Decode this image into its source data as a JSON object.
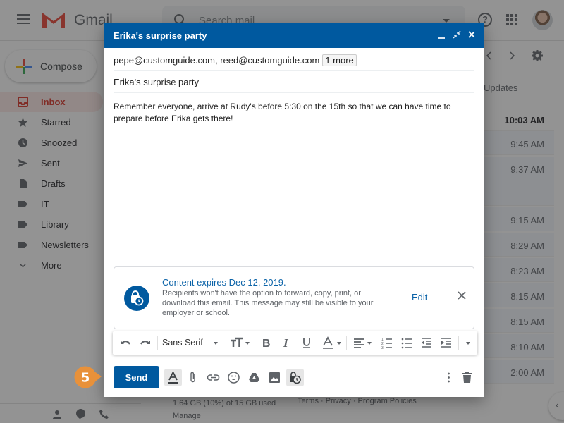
{
  "app": {
    "name": "Gmail",
    "search_placeholder": "Search mail",
    "compose_label": "Compose"
  },
  "sidebar": {
    "items": [
      {
        "label": "Inbox",
        "icon": "inbox-icon",
        "active": true
      },
      {
        "label": "Starred",
        "icon": "star-icon"
      },
      {
        "label": "Snoozed",
        "icon": "clock-icon"
      },
      {
        "label": "Sent",
        "icon": "send-icon"
      },
      {
        "label": "Drafts",
        "icon": "draft-icon"
      },
      {
        "label": "IT",
        "icon": "label-icon"
      },
      {
        "label": "Library",
        "icon": "label-icon"
      },
      {
        "label": "Newsletters",
        "icon": "label-icon"
      },
      {
        "label": "More",
        "icon": "chevron-down-icon"
      }
    ]
  },
  "inbox": {
    "tab_partial": "Updates",
    "times": [
      "10:03 AM",
      "9:45 AM",
      "9:37 AM",
      "9:15 AM",
      "8:29 AM",
      "8:23 AM",
      "8:15 AM",
      "8:15 AM",
      "8:10 AM",
      "2:00 AM"
    ]
  },
  "footer": {
    "storage": "1.64 GB (10%) of 15 GB used",
    "manage": "Manage",
    "links": "Terms · Privacy · Program Policies"
  },
  "compose": {
    "title": "Erika's surprise party",
    "recipients": "pepe@customguide.com, reed@customguide.com",
    "more_recipients": "1 more",
    "subject": "Erika's surprise party",
    "body": "Remember everyone, arrive at Rudy's before 5:30 on the 15th so that we can have time to prepare before Erika gets there!",
    "confidential": {
      "title": "Content expires Dec 12, 2019.",
      "description": "Recipients won't have the option to forward, copy, print, or download this email. This message may still be visible to your employer or school.",
      "edit_label": "Edit"
    },
    "format": {
      "font": "Sans Serif"
    },
    "send_label": "Send"
  },
  "callout": {
    "step": "5",
    "color": "#e8913a"
  },
  "colors": {
    "brand": "#00599f",
    "link": "#0b63a8"
  }
}
